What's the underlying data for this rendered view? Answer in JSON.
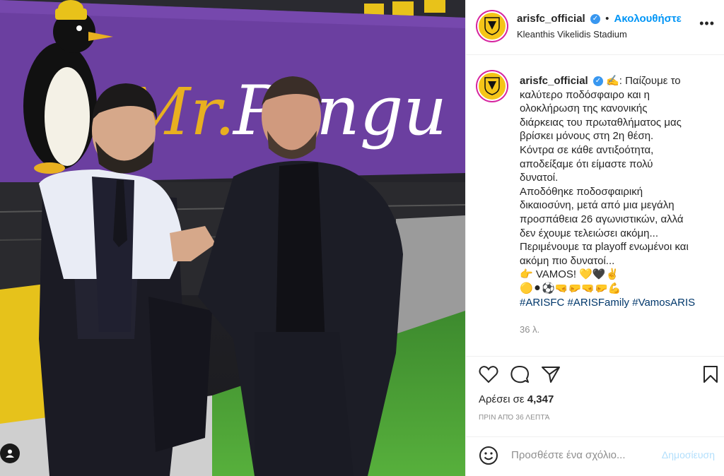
{
  "post": {
    "username": "arisfc_official",
    "verified_mark": "✓",
    "separator": "•",
    "follow_label": "Ακολουθήστε",
    "location": "Kleanthis Vikelidis Stadium",
    "more_label": "•••"
  },
  "photo": {
    "banner_text": "Mr. Pengu",
    "banner_color": "#6b3fa0"
  },
  "caption": {
    "username": "arisfc_official",
    "lines": [
      "✍️: Παίζουμε το",
      "καλύτερο ποδόσφαιρο και η",
      "ολοκλήρωση της κανονικής",
      "διάρκειας του πρωταθλήματος μας",
      "βρίσκει μόνους στη 2η θέση.",
      "Κόντρα σε κάθε αντιξοότητα,",
      "αποδείξαμε ότι είμαστε πολύ",
      "δυνατοί.",
      "Αποδόθηκε ποδοσφαιρική",
      "δικαιοσύνη, μετά από μια μεγάλη",
      "προσπάθεια 26 αγωνιστικών, αλλά",
      "δεν έχουμε τελειώσει ακόμη...",
      "Περιμένουμε τα playoff ενωμένοι και",
      "ακόμη πιο δυνατοί..."
    ],
    "vamos_line": "👉 VAMOS! 💛🖤✌️",
    "emoji_line": "🟡⚫⚽🤜🤛🤜🤛💪",
    "hashtags": [
      "#ARISFC",
      "#ARISFamily",
      "#VamosARIS"
    ],
    "time_ago": "36 λ."
  },
  "actions": {
    "likes_prefix": "Αρέσει σε",
    "likes_count": "4,347",
    "post_time": "ΠΡΙΝ ΑΠΌ 36 ΛΕΠΤΆ"
  },
  "comment": {
    "placeholder": "Προσθέστε ένα σχόλιο...",
    "publish_label": "Δημοσίευση"
  },
  "colors": {
    "accent": "#0095f6",
    "aris_yellow": "#f5c518",
    "hashtag": "#00376b"
  }
}
